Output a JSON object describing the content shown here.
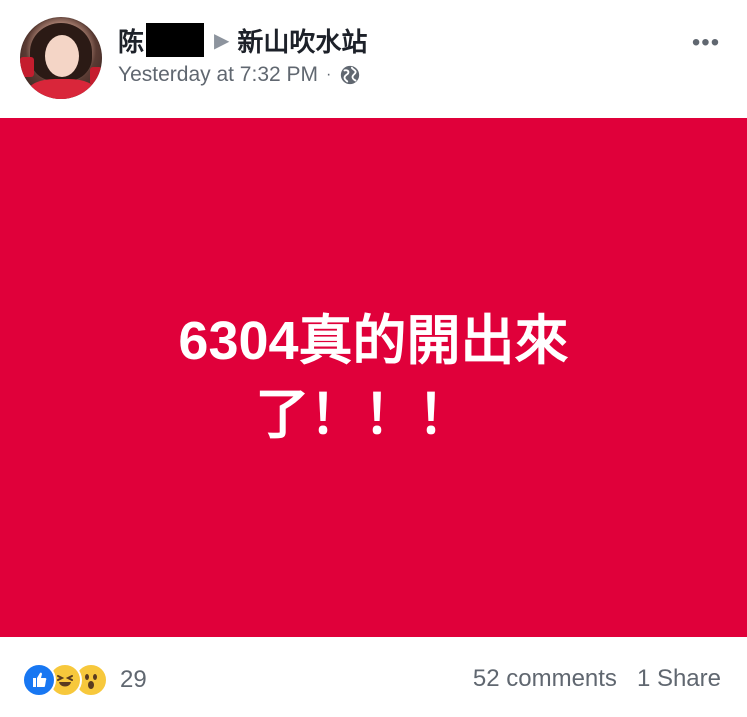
{
  "post": {
    "author_name": "陈",
    "arrow": "▶",
    "group_name": "新山吹水站",
    "timestamp": "Yesterday at 7:32 PM",
    "meta_separator": "·",
    "more_label": "•••",
    "image_text_line1": "6304真的開出來",
    "image_text_line2": "了！！！",
    "reaction_count": "29",
    "comments": "52 comments",
    "shares": "1 Share"
  },
  "colors": {
    "image_background": "#e0003a",
    "text_primary": "#1d2129",
    "text_secondary": "#606770",
    "like_blue": "#1877f2",
    "reaction_yellow": "#f7c83c"
  },
  "icons": {
    "avatar": "avatar",
    "globe": "globe-icon",
    "more": "more-icon",
    "like": "like-icon",
    "haha": "haha-icon",
    "wow": "wow-icon"
  }
}
